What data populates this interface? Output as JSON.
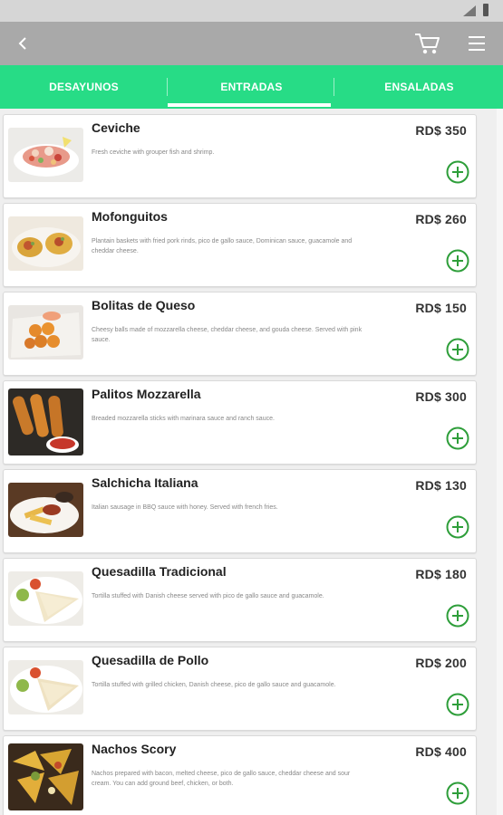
{
  "appbar": {
    "back_icon": "back-arrow-icon",
    "cart_icon": "cart-icon",
    "menu_icon": "menu-icon"
  },
  "tabs": [
    {
      "label": "DESAYUNOS",
      "selected": false
    },
    {
      "label": "ENTRADAS",
      "selected": true
    },
    {
      "label": "ENSALADAS",
      "selected": false
    }
  ],
  "colors": {
    "accent": "#27dc86",
    "appbar": "#a9a9a9",
    "add_button": "#2e9e3a"
  },
  "items": [
    {
      "name": "Ceviche",
      "price": "RD$ 350",
      "description": "Fresh ceviche with grouper fish and shrimp."
    },
    {
      "name": "Mofonguitos",
      "price": "RD$ 260",
      "description": "Plantain baskets with fried pork rinds, pico de gallo sauce, Dominican sauce, guacamole and cheddar cheese."
    },
    {
      "name": "Bolitas de Queso",
      "price": "RD$ 150",
      "description": "Cheesy balls made of mozzarella cheese, cheddar cheese, and gouda cheese. Served with pink sauce."
    },
    {
      "name": "Palitos Mozzarella",
      "price": "RD$ 300",
      "description": "Breaded mozzarella sticks with marinara sauce and ranch sauce."
    },
    {
      "name": "Salchicha Italiana",
      "price": "RD$ 130",
      "description": "Italian sausage in BBQ sauce with honey. Served with french fries."
    },
    {
      "name": "Quesadilla Tradicional",
      "price": "RD$ 180",
      "description": "Tortilla stuffed with Danish cheese served with pico de gallo sauce and guacamole."
    },
    {
      "name": "Quesadilla de Pollo",
      "price": "RD$ 200",
      "description": "Tortilla stuffed with grilled chicken, Danish cheese, pico de gallo sauce and guacamole."
    },
    {
      "name": "Nachos Scory",
      "price": "RD$ 400",
      "description": "Nachos prepared with bacon, melted cheese, pico de gallo sauce, cheddar cheese and sour cream. You can add ground beef, chicken, or both."
    }
  ]
}
